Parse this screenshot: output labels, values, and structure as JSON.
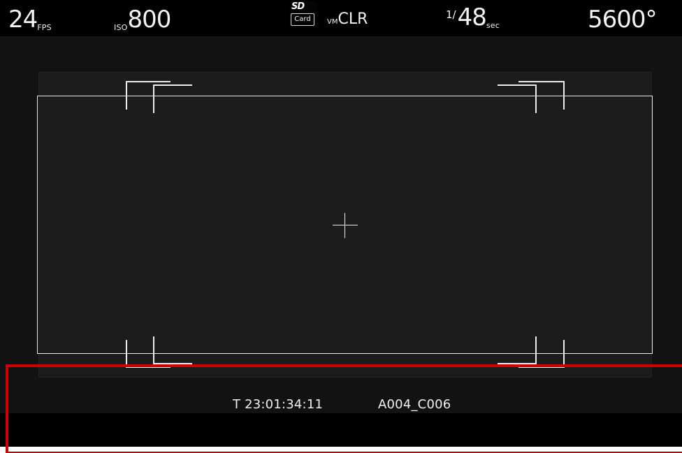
{
  "top_status": {
    "fps_value": "24",
    "fps_unit": "FPS",
    "iso_label": "ISO",
    "iso_value": "800",
    "sd_logo": "SD",
    "sd_card_label": "Card",
    "vm_label": "VM",
    "vm_value": "CLR",
    "shutter_fraction": "1/",
    "shutter_value": "48",
    "shutter_unit": "sec",
    "white_balance": "5600°"
  },
  "bottom_status": {
    "timecode": "T 23:01:34:11",
    "clip_name": "A004_C006"
  },
  "colors": {
    "screen_background": "#121212",
    "top_bar_background": "#000000",
    "frame_lines": "#ececec",
    "highlight_border": "#d10000"
  }
}
